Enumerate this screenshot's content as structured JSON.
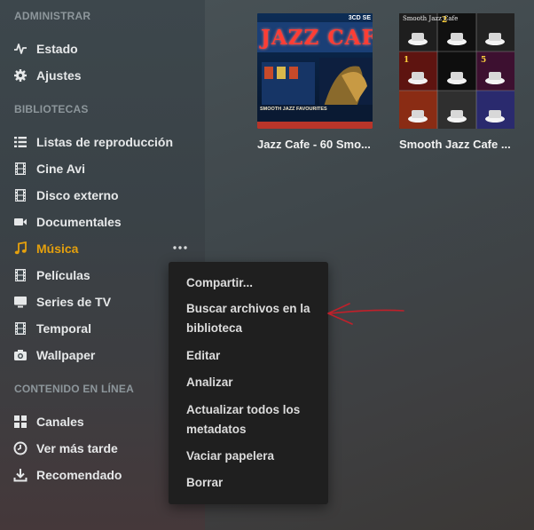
{
  "sidebar": {
    "admin_title": "ADMINISTRAR",
    "libraries_title": "BIBLIOTECAS",
    "online_title": "CONTENIDO EN LÍNEA",
    "admin_items": [
      {
        "label": "Estado",
        "icon": "activity-icon"
      },
      {
        "label": "Ajustes",
        "icon": "gear-icon"
      }
    ],
    "library_items": [
      {
        "label": "Listas de reproducción",
        "icon": "list-icon"
      },
      {
        "label": "Cine Avi",
        "icon": "film-icon"
      },
      {
        "label": "Disco externo",
        "icon": "film-icon"
      },
      {
        "label": "Documentales",
        "icon": "video-camera-icon"
      },
      {
        "label": "Música",
        "icon": "music-note-icon",
        "active": true
      },
      {
        "label": "Películas",
        "icon": "film-icon"
      },
      {
        "label": "Series de TV",
        "icon": "monitor-icon"
      },
      {
        "label": "Temporal",
        "icon": "film-icon"
      },
      {
        "label": "Wallpaper",
        "icon": "camera-icon"
      }
    ],
    "online_items": [
      {
        "label": "Canales",
        "icon": "grid-icon"
      },
      {
        "label": "Ver más tarde",
        "icon": "clock-icon"
      },
      {
        "label": "Recomendado",
        "icon": "download-icon"
      }
    ],
    "more_icon": "more-dots-icon"
  },
  "albums": [
    {
      "title": "Jazz Cafe - 60 Smo...",
      "cover_text": "JAZZ CAFE",
      "cover_badge": "3CD SE",
      "cover_sub": "SMOOTH JAZZ FAVOURITES"
    },
    {
      "title": "Smooth Jazz Cafe ...",
      "cover_text": "Smooth Jazz Cafe"
    }
  ],
  "context_menu": {
    "items": [
      "Compartir...",
      "Buscar archivos en la biblioteca",
      "Editar",
      "Analizar",
      "Actualizar todos los metadatos",
      "Vaciar papelera",
      "Borrar"
    ]
  },
  "colors": {
    "accent": "#e5a00d",
    "annotation_arrow": "#c0202a",
    "menu_bg": "#1f1f1f"
  }
}
